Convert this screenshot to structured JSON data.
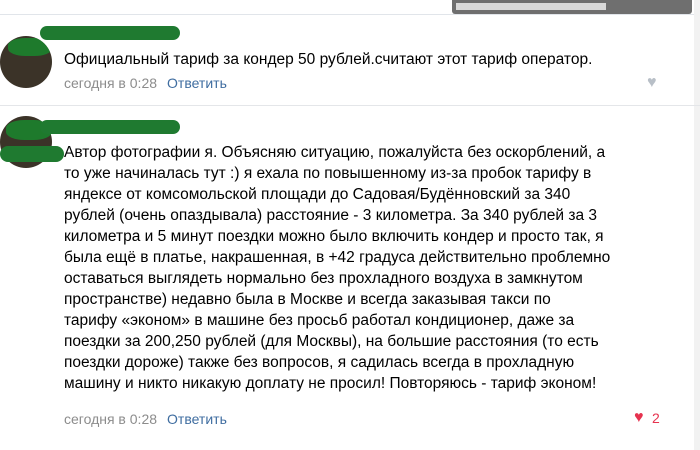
{
  "comments": [
    {
      "text": "Официальный тариф за кондер 50 рублей.считают этот тариф оператор.",
      "time": "сегодня в 0:28",
      "reply_label": "Ответить",
      "likes": ""
    },
    {
      "lines": [
        "Автор фотографии я. Объясняю ситуацию, пожалуйста без оскорблений, а",
        "то уже начиналась тут :) я ехала по повышенному из-за пробок тарифу в",
        "яндексе от комсомольской площади до Садовая/Будённовский за 340",
        "рублей (очень опаздывала) расстояние - 3 километра. За 340 рублей за 3",
        "километра и 5 минут поездки можно было включить кондер и просто так, я",
        "была ещё в платье, накрашенная, в +42 градуса действительно проблемно",
        "оставаться выглядеть нормально без прохладного воздуха в замкнутом",
        "пространстве) недавно была в Москве и всегда заказывая такси по",
        "тарифу «эконом» в машине без просьб работал кондиционер, даже за",
        "поездки за 200,250 рублей (для Москвы), на большие расстояния (то есть",
        "поездки дороже) также без вопросов, я садилась всегда в прохладную",
        "машину и никто никакую доплату не просил! Повторяюсь - тариф эконом!"
      ],
      "time": "сегодня в 0:28",
      "reply_label": "Ответить",
      "likes": "2"
    }
  ],
  "colors": {
    "link": "#3f6da0",
    "meta": "#8c8c8c",
    "like_active": "#e6334f",
    "like_inactive": "#b8bfc7"
  },
  "icons": {
    "like": "heart-icon"
  }
}
